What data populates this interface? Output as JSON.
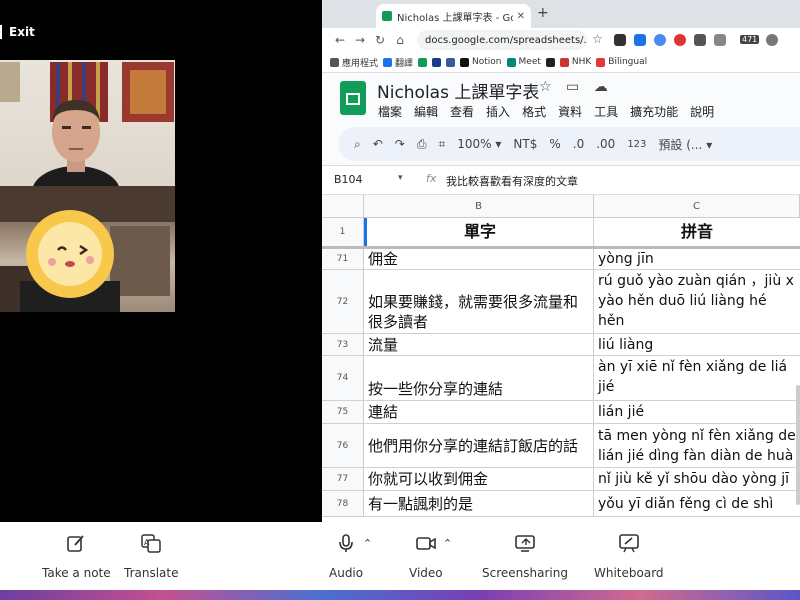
{
  "meeting": {
    "exit_label": "Exit",
    "controls": {
      "note_label": "Take a note",
      "translate_label": "Translate",
      "audio_label": "Audio",
      "video_label": "Video",
      "screensharing_label": "Screensharing",
      "whiteboard_label": "Whiteboard"
    }
  },
  "browser": {
    "tab_title": "Nicholas 上課單字表 - Google",
    "url": "docs.google.com/spreadsheets/...",
    "ext_badge": "471",
    "bookmarks": [
      "應用程式",
      "翻譯",
      "Notion",
      "Meet",
      "NHK",
      "Bilingual"
    ]
  },
  "sheet": {
    "title": "Nicholas 上課單字表",
    "menu": [
      "檔案",
      "編輯",
      "查看",
      "插入",
      "格式",
      "資料",
      "工具",
      "擴充功能",
      "說明"
    ],
    "toolbar": {
      "zoom": "100%",
      "currency": "NT$",
      "percent": "%",
      "dec_minus": ".0",
      "dec_plus": ".00",
      "number_fmt": "123",
      "font": "預設 (..."
    },
    "name_box": "B104",
    "formula": "我比較喜歡看有深度的文章",
    "columns": [
      "B",
      "C"
    ],
    "header_row": {
      "num": "1",
      "b": "單字",
      "c": "拼音"
    },
    "rows": [
      {
        "num": "71",
        "b": "佣金",
        "c": "yòng jīn"
      },
      {
        "num": "72",
        "b": "如果要賺錢，就需要很多流量和很多讀者",
        "c": "rú guǒ yào zuàn qián ，jiù x\nyào hěn duō liú liàng hé hěn\nduō dú zhě"
      },
      {
        "num": "73",
        "b": "流量",
        "c": "liú liàng"
      },
      {
        "num": "74",
        "b": "按一些你分享的連結",
        "c": "àn yī xiē nǐ fèn xiǎng de liá\njié"
      },
      {
        "num": "75",
        "b": "連結",
        "c": "lián jié"
      },
      {
        "num": "76",
        "b": "他們用你分享的連結訂飯店的話",
        "c": "tā men yòng nǐ fèn xiǎng de\nlián jié dìng fàn diàn de huà"
      },
      {
        "num": "77",
        "b": "你就可以收到佣金",
        "c": "nǐ jiù kě yǐ shōu dào yòng jī"
      },
      {
        "num": "78",
        "b": "有一點諷刺的是",
        "c": "yǒu yī diǎn fěng cì de shì"
      }
    ]
  },
  "colors": {
    "sheets_green": "#0f9d58",
    "selection_blue": "#1a73e8",
    "toolbar_bg": "#edf2fa"
  }
}
